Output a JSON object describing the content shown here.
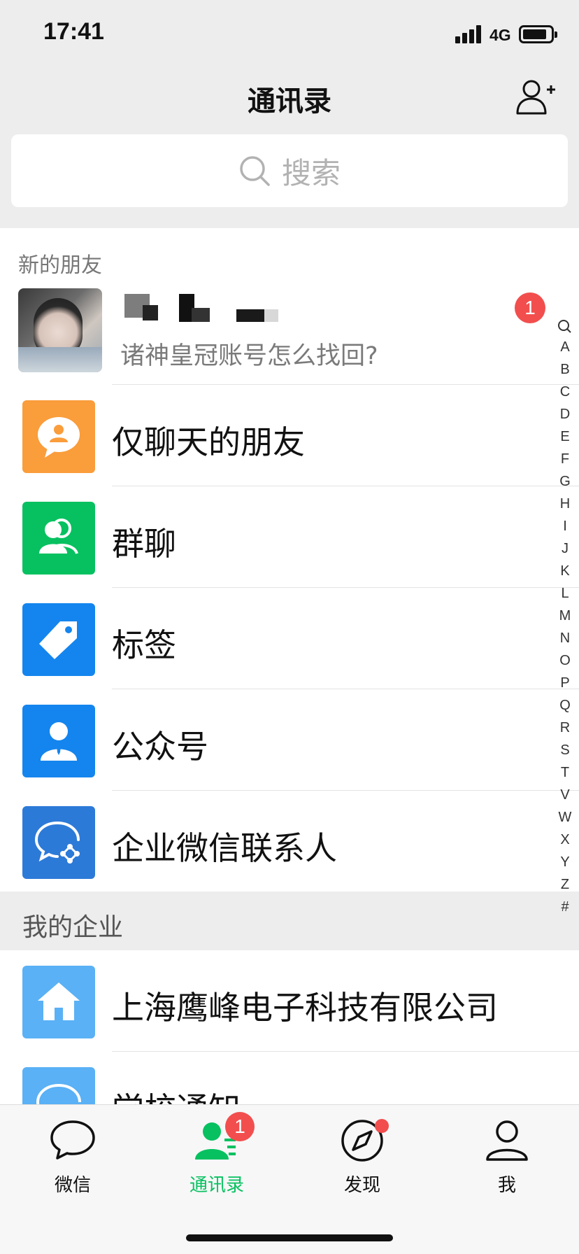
{
  "status": {
    "time": "17:41",
    "network": "4G"
  },
  "header": {
    "title": "通讯录"
  },
  "search": {
    "placeholder": "搜索"
  },
  "new_friends": {
    "section_label": "新的朋友",
    "request_message": "诸神皇冠账号怎么找回?",
    "badge": "1"
  },
  "entries": [
    {
      "label": "仅聊天的朋友",
      "icon": "chat-only-icon",
      "color": "#fa9d3b"
    },
    {
      "label": "群聊",
      "icon": "group-chat-icon",
      "color": "#07c160"
    },
    {
      "label": "标签",
      "icon": "tag-icon",
      "color": "#1485ee"
    },
    {
      "label": "公众号",
      "icon": "official-account-icon",
      "color": "#1485ee"
    },
    {
      "label": "企业微信联系人",
      "icon": "wecom-icon",
      "color": "#2c7ad8"
    }
  ],
  "company": {
    "section_label": "我的企业",
    "items": [
      {
        "label": "上海鹰峰电子科技有限公司",
        "icon": "home-icon",
        "color": "#5ab1f5"
      },
      {
        "label": "学校通知",
        "icon": "notice-icon",
        "color": "#5ab1f5"
      }
    ]
  },
  "index": [
    "A",
    "B",
    "C",
    "D",
    "E",
    "F",
    "G",
    "H",
    "I",
    "J",
    "K",
    "L",
    "M",
    "N",
    "O",
    "P",
    "Q",
    "R",
    "S",
    "T",
    "V",
    "W",
    "X",
    "Y",
    "Z",
    "#"
  ],
  "tabs": [
    {
      "label": "微信",
      "icon": "chat-bubble-icon"
    },
    {
      "label": "通讯录",
      "icon": "contacts-icon",
      "badge": "1"
    },
    {
      "label": "发现",
      "icon": "compass-icon"
    },
    {
      "label": "我",
      "icon": "person-icon"
    }
  ],
  "colors": {
    "accent": "#07c160",
    "badge": "#f24e4e"
  }
}
